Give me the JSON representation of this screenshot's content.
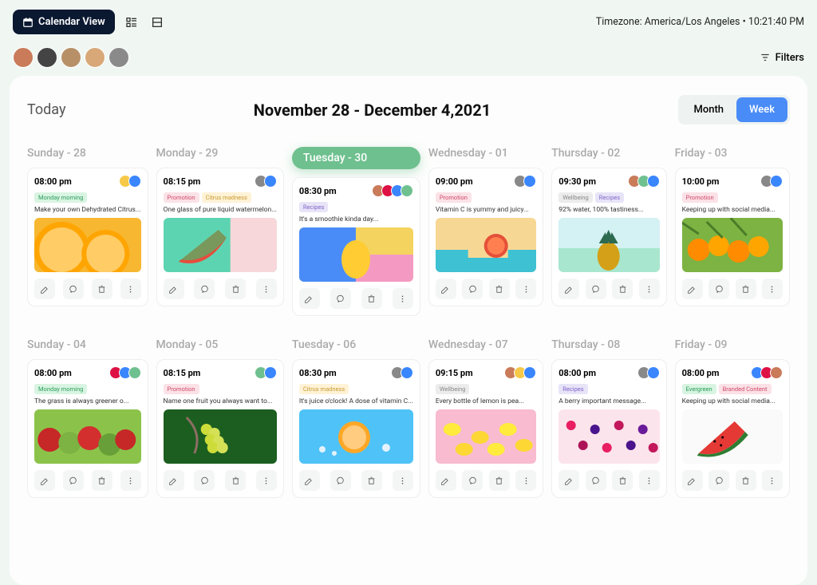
{
  "header": {
    "calendar_view_label": "Calendar View",
    "timezone_text": "Timezone: America/Los Angeles • 10:21:40 PM",
    "filters_label": "Filters"
  },
  "panel": {
    "today_label": "Today",
    "date_range": "November 28 - December 4,2021",
    "month_label": "Month",
    "week_label": "Week"
  },
  "avatar_colors": [
    "#c97b5a",
    "#444",
    "#b89068",
    "#d8a878",
    "#8a8a8a"
  ],
  "tag_styles": {
    "monday_morning": {
      "bg": "#d9f4e2",
      "fg": "#2a9d5a"
    },
    "promotion": {
      "bg": "#fbe2e7",
      "fg": "#d1486a"
    },
    "citrus_madness": {
      "bg": "#fff2d6",
      "fg": "#c79a2e"
    },
    "recipes": {
      "bg": "#e8e4f8",
      "fg": "#8066c9"
    },
    "wellbeing": {
      "bg": "#ececec",
      "fg": "#888"
    },
    "evergreen": {
      "bg": "#d9f4e2",
      "fg": "#2a9d5a"
    },
    "branded_content": {
      "bg": "#fbe2e7",
      "fg": "#d1486a"
    }
  },
  "days_row1": [
    {
      "header": "Sunday - 28",
      "active": false,
      "card": {
        "time": "08:00 pm",
        "avatars": [
          "#f7c948",
          "#3a86ff"
        ],
        "tags": [
          {
            "style": "monday_morning",
            "label": "Monday morning"
          }
        ],
        "desc": "Make your own Dehydrated Citrus...",
        "img_type": "orange"
      }
    },
    {
      "header": "Monday - 29",
      "active": false,
      "card": {
        "time": "08:15 pm",
        "avatars": [
          "#888",
          "#3a86ff"
        ],
        "tags": [
          {
            "style": "promotion",
            "label": "Promotion"
          },
          {
            "style": "citrus_madness",
            "label": "Citrus madness"
          }
        ],
        "desc": "One glass of pure liquid watermelon...",
        "img_type": "watermelon"
      }
    },
    {
      "header": "Tuesday - 30",
      "active": true,
      "card": {
        "time": "08:30 pm",
        "avatars": [
          "#c97b5a",
          "#d14",
          "#3a86ff",
          "#6fc08f"
        ],
        "tags": [
          {
            "style": "recipes",
            "label": "Recipes"
          }
        ],
        "desc": "It's a smoothie kinda day...",
        "img_type": "mango"
      }
    },
    {
      "header": "Wednesday - 01",
      "active": false,
      "card": {
        "time": "09:00 pm",
        "avatars": [
          "#888",
          "#3a86ff"
        ],
        "tags": [
          {
            "style": "promotion",
            "label": "Promotion"
          }
        ],
        "desc": "Vitamin C is yummy and juicy...",
        "img_type": "grapefruit"
      }
    },
    {
      "header": "Thursday - 02",
      "active": false,
      "card": {
        "time": "09:30 pm",
        "avatars": [
          "#c97b5a",
          "#6fc08f",
          "#3a86ff"
        ],
        "tags": [
          {
            "style": "wellbeing",
            "label": "Wellbeing"
          },
          {
            "style": "recipes",
            "label": "Recipes"
          }
        ],
        "desc": "92% water, 100% tastiness...",
        "img_type": "pineapple"
      }
    },
    {
      "header": "Friday - 03",
      "active": false,
      "card": {
        "time": "10:00 pm",
        "avatars": [
          "#888",
          "#3a86ff"
        ],
        "tags": [
          {
            "style": "promotion",
            "label": "Promotion"
          }
        ],
        "desc": "Keeping up with social media...",
        "img_type": "oranges_green"
      }
    }
  ],
  "days_row2": [
    {
      "header": "Sunday - 04",
      "active": false,
      "card": {
        "time": "08:00 pm",
        "avatars": [
          "#d14",
          "#3a86ff",
          "#6fc08f"
        ],
        "tags": [
          {
            "style": "monday_morning",
            "label": "Monday morning"
          }
        ],
        "desc": "The grass is always greener o...",
        "img_type": "apples"
      }
    },
    {
      "header": "Monday - 05",
      "active": false,
      "card": {
        "time": "08:15 pm",
        "avatars": [
          "#6fc08f",
          "#3a86ff"
        ],
        "tags": [
          {
            "style": "promotion",
            "label": "Promotion"
          }
        ],
        "desc": "Name one fruit you always want to...",
        "img_type": "grapes"
      }
    },
    {
      "header": "Tuesday - 06",
      "active": false,
      "card": {
        "time": "08:30 pm",
        "avatars": [
          "#888",
          "#3a86ff"
        ],
        "tags": [
          {
            "style": "citrus_madness",
            "label": "Citrus madness"
          }
        ],
        "desc": "It's juice o'clock! A dose of vitamin C...",
        "img_type": "orange_water"
      }
    },
    {
      "header": "Wednesday - 07",
      "active": false,
      "card": {
        "time": "09:15 pm",
        "avatars": [
          "#c97b5a",
          "#f7c948",
          "#3a86ff"
        ],
        "tags": [
          {
            "style": "wellbeing",
            "label": "Wellbeing"
          }
        ],
        "desc": "Every bottle of lemon is pea...",
        "img_type": "lemons"
      }
    },
    {
      "header": "Thursday - 08",
      "active": false,
      "card": {
        "time": "08:00 pm",
        "avatars": [
          "#888",
          "#3a86ff"
        ],
        "tags": [
          {
            "style": "recipes",
            "label": "Recipes"
          }
        ],
        "desc": "A berry important message...",
        "img_type": "berries"
      }
    },
    {
      "header": "Friday - 09",
      "active": false,
      "card": {
        "time": "08:00 pm",
        "avatars": [
          "#3a86ff",
          "#d14",
          "#c97b5a"
        ],
        "tags": [
          {
            "style": "evergreen",
            "label": "Evergreen"
          },
          {
            "style": "branded_content",
            "label": "Branded Content"
          }
        ],
        "desc": "Keeping up with social media...",
        "img_type": "watermelon2"
      }
    }
  ],
  "img_svgs": {
    "orange": {
      "bg": "#f7b731",
      "shapes": "<circle cx='40' cy='40' r='35' fill='#ffa502'/><circle cx='40' cy='40' r='28' fill='#ffcc66'/><circle cx='95' cy='45' r='30' fill='#ffa502'/><circle cx='95' cy='45' r='24' fill='#ffcc66'/>"
    },
    "watermelon": {
      "bg": "#5dd4b1",
      "shapes": "<path d='M20 55 L70 15 L80 25 Q55 65 20 55 Z' fill='#e74c3c'/><path d='M20 55 L70 15 L80 25 L76 30 Q50 58 22 52 Z' fill='#2ecc71' opacity='0.6'/><rect x='85' y='0' width='60' height='68' fill='#f8d7da'/>"
    },
    "mango": {
      "bg": "#f4d35e",
      "shapes": "<rect x='0' y='0' width='72' height='68' fill='#4a8cf7'/><rect x='72' y='34' width='72' height='34' fill='#f49ac2'/><ellipse cx='72' cy='40' rx='18' ry='24' fill='#ffcc33'/>"
    },
    "grapefruit": {
      "bg": "#f7d794",
      "shapes": "<rect x='0' y='40' width='145' height='28' fill='#3dc1d3'/><rect x='50' y='10' width='50' height='40' fill='#f7d794'/><circle cx='85' cy='35' r='15' fill='#e55039'/><circle cx='85' cy='35' r='11' fill='#ff7f50'/>"
    },
    "pineapple": {
      "bg": "#a8e6cf",
      "shapes": "<rect x='0' y='0' width='145' height='38' fill='#d4f1f4'/><ellipse cx='72' cy='48' rx='14' ry='18' fill='#d4a017'/><path d='M65 30 L72 15 L79 30 Z' fill='#2d6a4f'/><path d='M60 32 L68 18 L72 32 Z' fill='#2d6a4f'/><path d='M72 32 L76 18 L84 32 Z' fill='#2d6a4f'/>"
    },
    "oranges_green": {
      "bg": "#7cb342",
      "shapes": "<circle cx='30' cy='40' r='14' fill='#ff8c00'/><circle cx='55' cy='35' r='13' fill='#ffa500'/><circle cx='80' cy='42' r='14' fill='#ff8c00'/><circle cx='105' cy='36' r='13' fill='#ffa500'/><path d='M0 0 L30 20 M40 5 L60 25 M70 0 L90 22' stroke='#4a7c28' stroke-width='3'/>"
    },
    "apples": {
      "bg": "#8bc34a",
      "shapes": "<circle cx='25' cy='38' r='15' fill='#c62828'/><circle cx='50' cy='42' r='14' fill='#7cb342'/><circle cx='75' cy='36' r='15' fill='#d32f2f'/><circle cx='100' cy='44' r='14' fill='#689f38'/><circle cx='120' cy='38' r='13' fill='#c62828'/>"
    },
    "grapes": {
      "bg": "#1b5e20",
      "shapes": "<circle cx='55' cy='25' r='7' fill='#cddc39'/><circle cx='65' cy='30' r='7' fill='#d4e157'/><circle cx='60' cy='38' r='7' fill='#cddc39'/><circle cx='70' cy='40' r='7' fill='#d4e157'/><circle cx='63' cy='48' r='7' fill='#cddc39'/><circle cx='75' cy='48' r='7' fill='#d4e157'/><path d='M30 10 Q50 30 40 55' stroke='#8d6e63' stroke-width='3' fill='none'/>"
    },
    "orange_water": {
      "bg": "#4fc3f7",
      "shapes": "<circle cx='70' cy='35' r='20' fill='#ffa726'/><circle cx='70' cy='35' r='15' fill='#ffcc80'/><circle cx='30' cy='50' r='4' fill='#e3f2fd'/><circle cx='110' cy='48' r='5' fill='#e3f2fd'/><circle cx='45' cy='55' r='3' fill='#e3f2fd'/>"
    },
    "lemons": {
      "bg": "#f8bbd0",
      "shapes": "<ellipse cx='30' cy='25' rx='11' ry='8' fill='#ffeb3b'/><ellipse cx='65' cy='35' rx='11' ry='8' fill='#fdd835'/><ellipse cx='100' cy='25' rx='11' ry='8' fill='#ffeb3b'/><ellipse cx='45' cy='50' rx='11' ry='8' fill='#fdd835'/><ellipse cx='85' cy='50' rx='11' ry='8' fill='#ffeb3b'/><ellipse cx='120' cy='45' rx='11' ry='8' fill='#fdd835'/>"
    },
    "berries": {
      "bg": "#fce4ec",
      "shapes": "<circle cx='25' cy='20' r='6' fill='#e91e63'/><circle cx='55' cy='25' r='6' fill='#4a148c'/><circle cx='85' cy='20' r='6' fill='#c2185b'/><circle cx='115' cy='25' r='6' fill='#6a1b9a'/><circle cx='40' cy='45' r='6' fill='#ad1457'/><circle cx='70' cy='48' r='6' fill='#e91e63'/><circle cx='100' cy='45' r='6' fill='#4a148c'/><circle cx='128' cy='48' r='6' fill='#c2185b'/>"
    },
    "watermelon2": {
      "bg": "#fafafa",
      "shapes": "<path d='M30 55 L75 15 L88 28 Q62 62 30 55 Z' fill='#e53935'/><path d='M28 57 L75 15 L78 18 Q50 55 28 57 Z' fill='#2e7d32' opacity='0'/><path d='M30 55 Q62 62 88 28 L92 32 Q64 66 28 58 Z' fill='#2e7d32'/><circle cx='50' cy='40' r='1.5' fill='#000'/><circle cx='60' cy='35' r='1.5' fill='#000'/><circle cx='58' cy='45' r='1.5' fill='#000'/>"
    }
  }
}
